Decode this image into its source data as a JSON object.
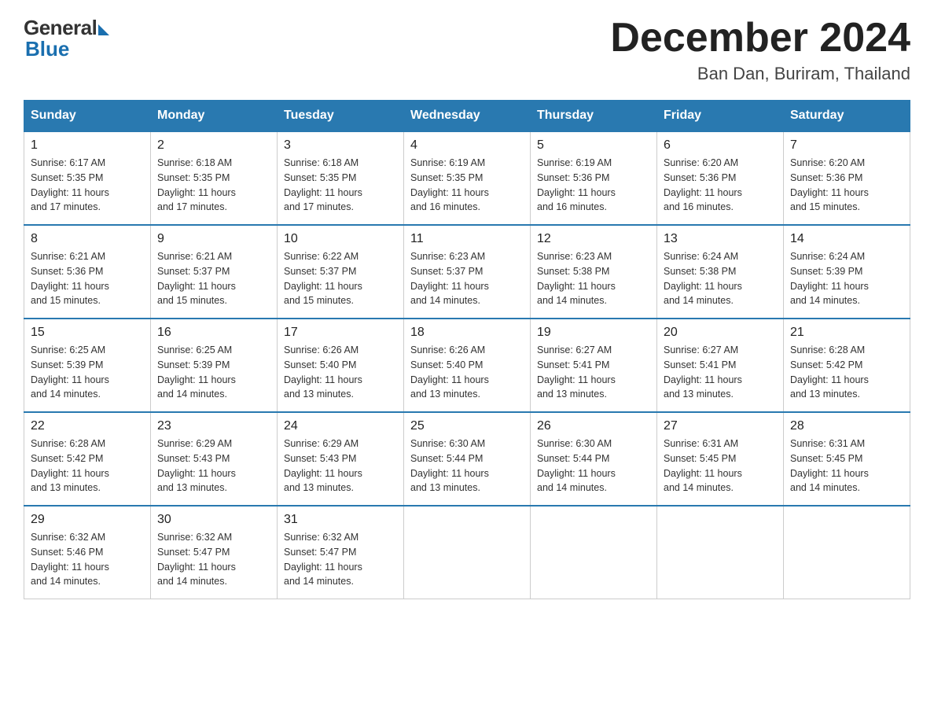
{
  "logo": {
    "general": "General",
    "blue": "Blue"
  },
  "header": {
    "month_year": "December 2024",
    "location": "Ban Dan, Buriram, Thailand"
  },
  "days_of_week": [
    "Sunday",
    "Monday",
    "Tuesday",
    "Wednesday",
    "Thursday",
    "Friday",
    "Saturday"
  ],
  "weeks": [
    [
      {
        "day": "1",
        "sunrise": "6:17 AM",
        "sunset": "5:35 PM",
        "daylight": "11 hours and 17 minutes."
      },
      {
        "day": "2",
        "sunrise": "6:18 AM",
        "sunset": "5:35 PM",
        "daylight": "11 hours and 17 minutes."
      },
      {
        "day": "3",
        "sunrise": "6:18 AM",
        "sunset": "5:35 PM",
        "daylight": "11 hours and 17 minutes."
      },
      {
        "day": "4",
        "sunrise": "6:19 AM",
        "sunset": "5:35 PM",
        "daylight": "11 hours and 16 minutes."
      },
      {
        "day": "5",
        "sunrise": "6:19 AM",
        "sunset": "5:36 PM",
        "daylight": "11 hours and 16 minutes."
      },
      {
        "day": "6",
        "sunrise": "6:20 AM",
        "sunset": "5:36 PM",
        "daylight": "11 hours and 16 minutes."
      },
      {
        "day": "7",
        "sunrise": "6:20 AM",
        "sunset": "5:36 PM",
        "daylight": "11 hours and 15 minutes."
      }
    ],
    [
      {
        "day": "8",
        "sunrise": "6:21 AM",
        "sunset": "5:36 PM",
        "daylight": "11 hours and 15 minutes."
      },
      {
        "day": "9",
        "sunrise": "6:21 AM",
        "sunset": "5:37 PM",
        "daylight": "11 hours and 15 minutes."
      },
      {
        "day": "10",
        "sunrise": "6:22 AM",
        "sunset": "5:37 PM",
        "daylight": "11 hours and 15 minutes."
      },
      {
        "day": "11",
        "sunrise": "6:23 AM",
        "sunset": "5:37 PM",
        "daylight": "11 hours and 14 minutes."
      },
      {
        "day": "12",
        "sunrise": "6:23 AM",
        "sunset": "5:38 PM",
        "daylight": "11 hours and 14 minutes."
      },
      {
        "day": "13",
        "sunrise": "6:24 AM",
        "sunset": "5:38 PM",
        "daylight": "11 hours and 14 minutes."
      },
      {
        "day": "14",
        "sunrise": "6:24 AM",
        "sunset": "5:39 PM",
        "daylight": "11 hours and 14 minutes."
      }
    ],
    [
      {
        "day": "15",
        "sunrise": "6:25 AM",
        "sunset": "5:39 PM",
        "daylight": "11 hours and 14 minutes."
      },
      {
        "day": "16",
        "sunrise": "6:25 AM",
        "sunset": "5:39 PM",
        "daylight": "11 hours and 14 minutes."
      },
      {
        "day": "17",
        "sunrise": "6:26 AM",
        "sunset": "5:40 PM",
        "daylight": "11 hours and 13 minutes."
      },
      {
        "day": "18",
        "sunrise": "6:26 AM",
        "sunset": "5:40 PM",
        "daylight": "11 hours and 13 minutes."
      },
      {
        "day": "19",
        "sunrise": "6:27 AM",
        "sunset": "5:41 PM",
        "daylight": "11 hours and 13 minutes."
      },
      {
        "day": "20",
        "sunrise": "6:27 AM",
        "sunset": "5:41 PM",
        "daylight": "11 hours and 13 minutes."
      },
      {
        "day": "21",
        "sunrise": "6:28 AM",
        "sunset": "5:42 PM",
        "daylight": "11 hours and 13 minutes."
      }
    ],
    [
      {
        "day": "22",
        "sunrise": "6:28 AM",
        "sunset": "5:42 PM",
        "daylight": "11 hours and 13 minutes."
      },
      {
        "day": "23",
        "sunrise": "6:29 AM",
        "sunset": "5:43 PM",
        "daylight": "11 hours and 13 minutes."
      },
      {
        "day": "24",
        "sunrise": "6:29 AM",
        "sunset": "5:43 PM",
        "daylight": "11 hours and 13 minutes."
      },
      {
        "day": "25",
        "sunrise": "6:30 AM",
        "sunset": "5:44 PM",
        "daylight": "11 hours and 13 minutes."
      },
      {
        "day": "26",
        "sunrise": "6:30 AM",
        "sunset": "5:44 PM",
        "daylight": "11 hours and 14 minutes."
      },
      {
        "day": "27",
        "sunrise": "6:31 AM",
        "sunset": "5:45 PM",
        "daylight": "11 hours and 14 minutes."
      },
      {
        "day": "28",
        "sunrise": "6:31 AM",
        "sunset": "5:45 PM",
        "daylight": "11 hours and 14 minutes."
      }
    ],
    [
      {
        "day": "29",
        "sunrise": "6:32 AM",
        "sunset": "5:46 PM",
        "daylight": "11 hours and 14 minutes."
      },
      {
        "day": "30",
        "sunrise": "6:32 AM",
        "sunset": "5:47 PM",
        "daylight": "11 hours and 14 minutes."
      },
      {
        "day": "31",
        "sunrise": "6:32 AM",
        "sunset": "5:47 PM",
        "daylight": "11 hours and 14 minutes."
      },
      null,
      null,
      null,
      null
    ]
  ],
  "labels": {
    "sunrise": "Sunrise:",
    "sunset": "Sunset:",
    "daylight": "Daylight:"
  }
}
